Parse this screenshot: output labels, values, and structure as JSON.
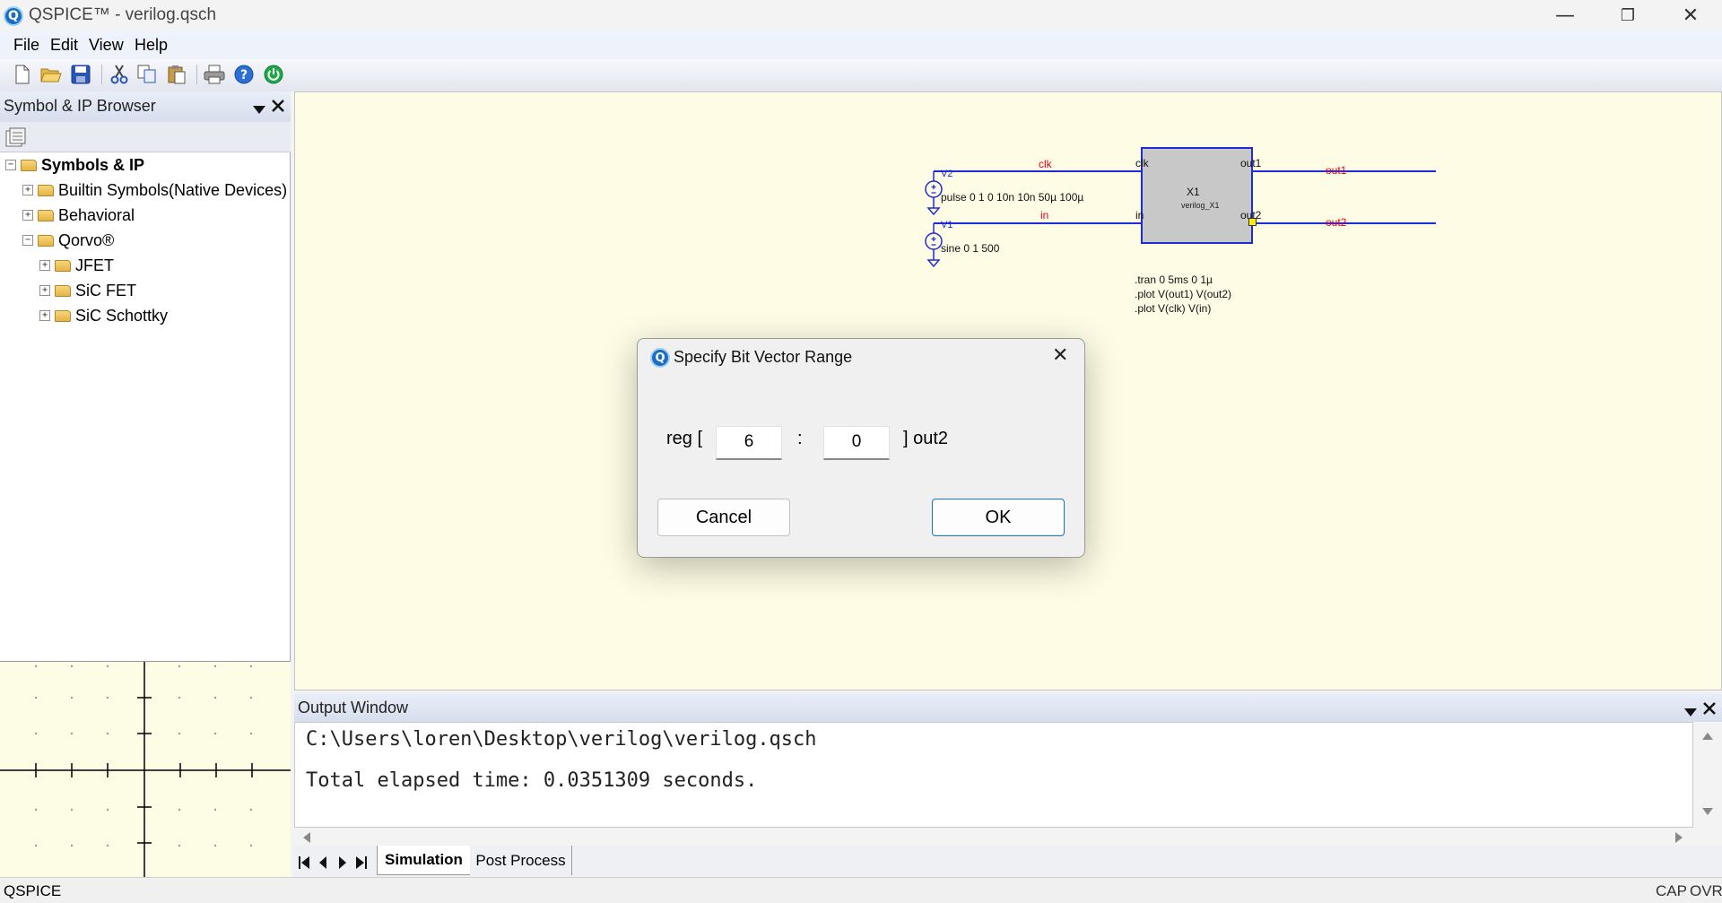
{
  "window": {
    "title": "QSPICE™ - verilog.qsch",
    "logo_letter": "Q",
    "minimize_glyph": "—",
    "restore_glyph": "❐",
    "close_glyph": "✕"
  },
  "menu": {
    "items": [
      "File",
      "Edit",
      "View",
      "Help"
    ]
  },
  "toolbar": {
    "icons": [
      "new-file-icon",
      "open-folder-icon",
      "save-icon",
      "cut-icon",
      "copy-icon",
      "paste-icon",
      "print-icon",
      "help-icon",
      "power-icon"
    ]
  },
  "symbol_browser": {
    "title": "Symbol & IP Browser",
    "tree": [
      {
        "label": "Symbols & IP",
        "expander": "−",
        "level": 0,
        "bold": true
      },
      {
        "label": "Builtin Symbols(Native Devices)",
        "expander": "+",
        "level": 1
      },
      {
        "label": "Behavioral",
        "expander": "+",
        "level": 1
      },
      {
        "label": "Qorvo®",
        "expander": "−",
        "level": 1
      },
      {
        "label": "JFET",
        "expander": "+",
        "level": 2
      },
      {
        "label": "SiC FET",
        "expander": "+",
        "level": 2
      },
      {
        "label": "SiC Schottky",
        "expander": "+",
        "level": 2
      }
    ]
  },
  "schematic": {
    "net_labels": {
      "clk": "clk",
      "in": "in",
      "out1": "out1",
      "out2": "out2"
    },
    "sources": {
      "v2_name": "V2",
      "v2_value": "pulse 0 1 0 10n 10n 50µ 100µ",
      "v1_name": "V1",
      "v1_value": "sine 0 1 500"
    },
    "block": {
      "name": "X1",
      "sub": "verilog_X1",
      "pin_clk": "clk",
      "pin_in": "in",
      "pin_out1": "out1",
      "pin_out2": "out2"
    },
    "directives": [
      ".tran 0 5ms 0 1µ",
      ".plot V(out1) V(out2)",
      ".plot V(clk) V(in)"
    ],
    "colors": {
      "wire": "#1f2ad8",
      "net_label": "#e0001b",
      "block_fill": "#c8c8c8",
      "background": "#fffce5"
    }
  },
  "dialog": {
    "title": "Specify Bit Vector Range",
    "prefix": "reg [",
    "from_value": "6",
    "separator": ":",
    "to_value": "0",
    "suffix": "] out2",
    "cancel_label": "Cancel",
    "ok_label": "OK",
    "close_glyph": "✕"
  },
  "output_window": {
    "title": "Output Window",
    "lines": [
      "C:\\Users\\loren\\Desktop\\verilog\\verilog.qsch",
      "Total elapsed time: 0.0351309 seconds."
    ],
    "tabs": [
      {
        "label": "Simulation",
        "active": true
      },
      {
        "label": "Post Process",
        "active": false
      }
    ]
  },
  "status_bar": {
    "left": "QSPICE",
    "cap": "CAP",
    "ovr": "OVR"
  }
}
